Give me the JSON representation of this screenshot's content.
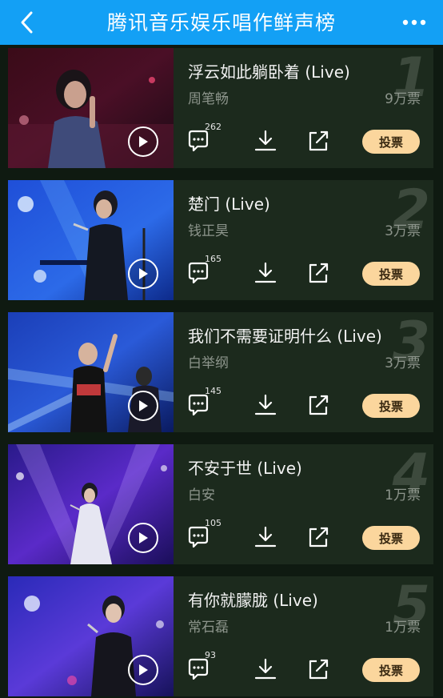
{
  "header": {
    "title": "腾讯音乐娱乐唱作鲜声榜",
    "back_icon": "chevron-left-icon",
    "more_icon": "more-dots-icon",
    "bg_color": "#13a0f5"
  },
  "items": [
    {
      "rank": "1",
      "song": "浮云如此躺卧着 (Live)",
      "artist": "周笔畅",
      "votes": "9万票",
      "comments": "262",
      "vote_label": "投票"
    },
    {
      "rank": "2",
      "song": "楚门 (Live)",
      "artist": "钱正昊",
      "votes": "3万票",
      "comments": "165",
      "vote_label": "投票"
    },
    {
      "rank": "3",
      "song": "我们不需要证明什么 (Live)",
      "artist": "白举纲",
      "votes": "3万票",
      "comments": "145",
      "vote_label": "投票"
    },
    {
      "rank": "4",
      "song": "不安于世 (Live)",
      "artist": "白安",
      "votes": "1万票",
      "comments": "105",
      "vote_label": "投票"
    },
    {
      "rank": "5",
      "song": "有你就朦胧 (Live)",
      "artist": "常石磊",
      "votes": "1万票",
      "comments": "93",
      "vote_label": "投票"
    }
  ],
  "colors": {
    "accent_vote": "#fbd69d",
    "card_bg": "#1c2a1d",
    "page_bg": "#0f1a11"
  }
}
